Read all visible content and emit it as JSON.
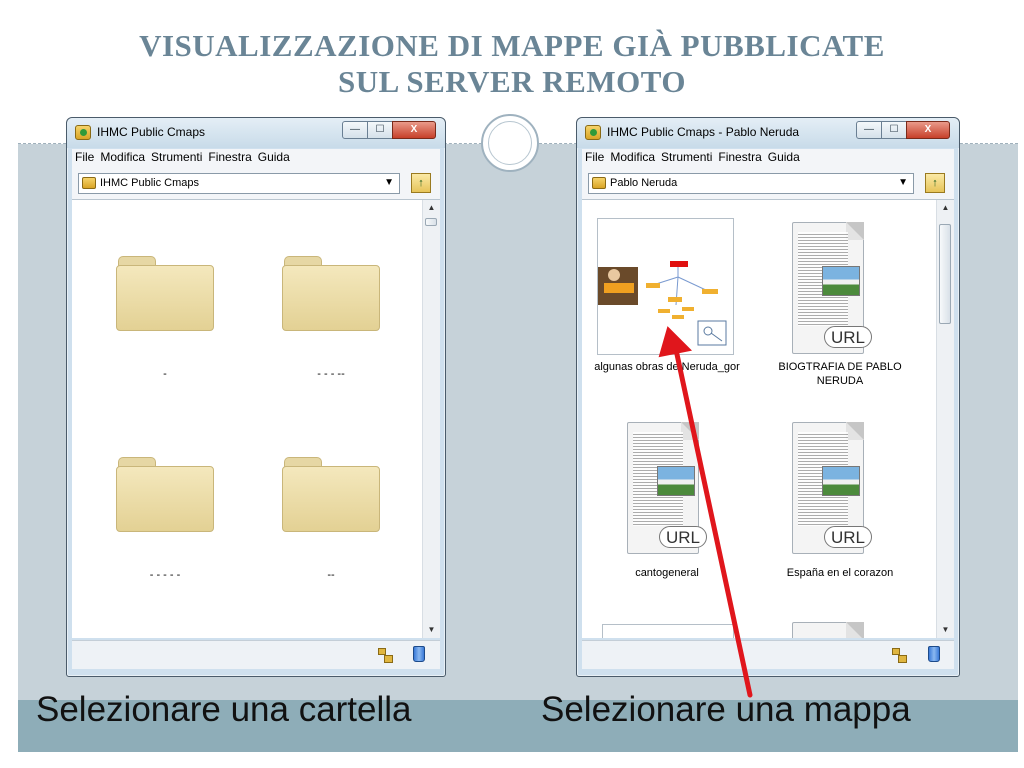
{
  "slide": {
    "title_line1": "VISUALIZZAZIONE DI MAPPE GIÀ PUBBLICATE",
    "title_line2": "SUL SERVER REMOTO",
    "caption_left": "Selezionare una cartella",
    "caption_right": "Selezionare una mappa"
  },
  "menu": [
    "File",
    "Modifica",
    "Strumenti",
    "Finestra",
    "Guida"
  ],
  "left_window": {
    "title": "IHMC Public Cmaps",
    "location": "IHMC Public Cmaps",
    "folders": [
      "-",
      "- - - --",
      "- - - - -",
      "--"
    ]
  },
  "right_window": {
    "title": "IHMC Public Cmaps - Pablo Neruda",
    "location": "Pablo Neruda",
    "items": [
      {
        "label": "algunas obras de Neruda_gor",
        "type": "cmap"
      },
      {
        "label": "BIOGTRAFIA DE PABLO NERUDA",
        "type": "url"
      },
      {
        "label": "cantogeneral",
        "type": "url"
      },
      {
        "label": "España en el corazon",
        "type": "url"
      }
    ],
    "url_badge": "URL"
  },
  "controls": {
    "minimize": "—",
    "maximize": "☐",
    "close": "X",
    "up_folder": "↑",
    "dropdown_arrow": "▼",
    "scroll_up": "▲",
    "scroll_down": "▼"
  },
  "colors": {
    "title": "#6a8596",
    "band": "#c6d2d9",
    "band_bottom": "#8eadb8",
    "arrow": "#e0161c"
  }
}
